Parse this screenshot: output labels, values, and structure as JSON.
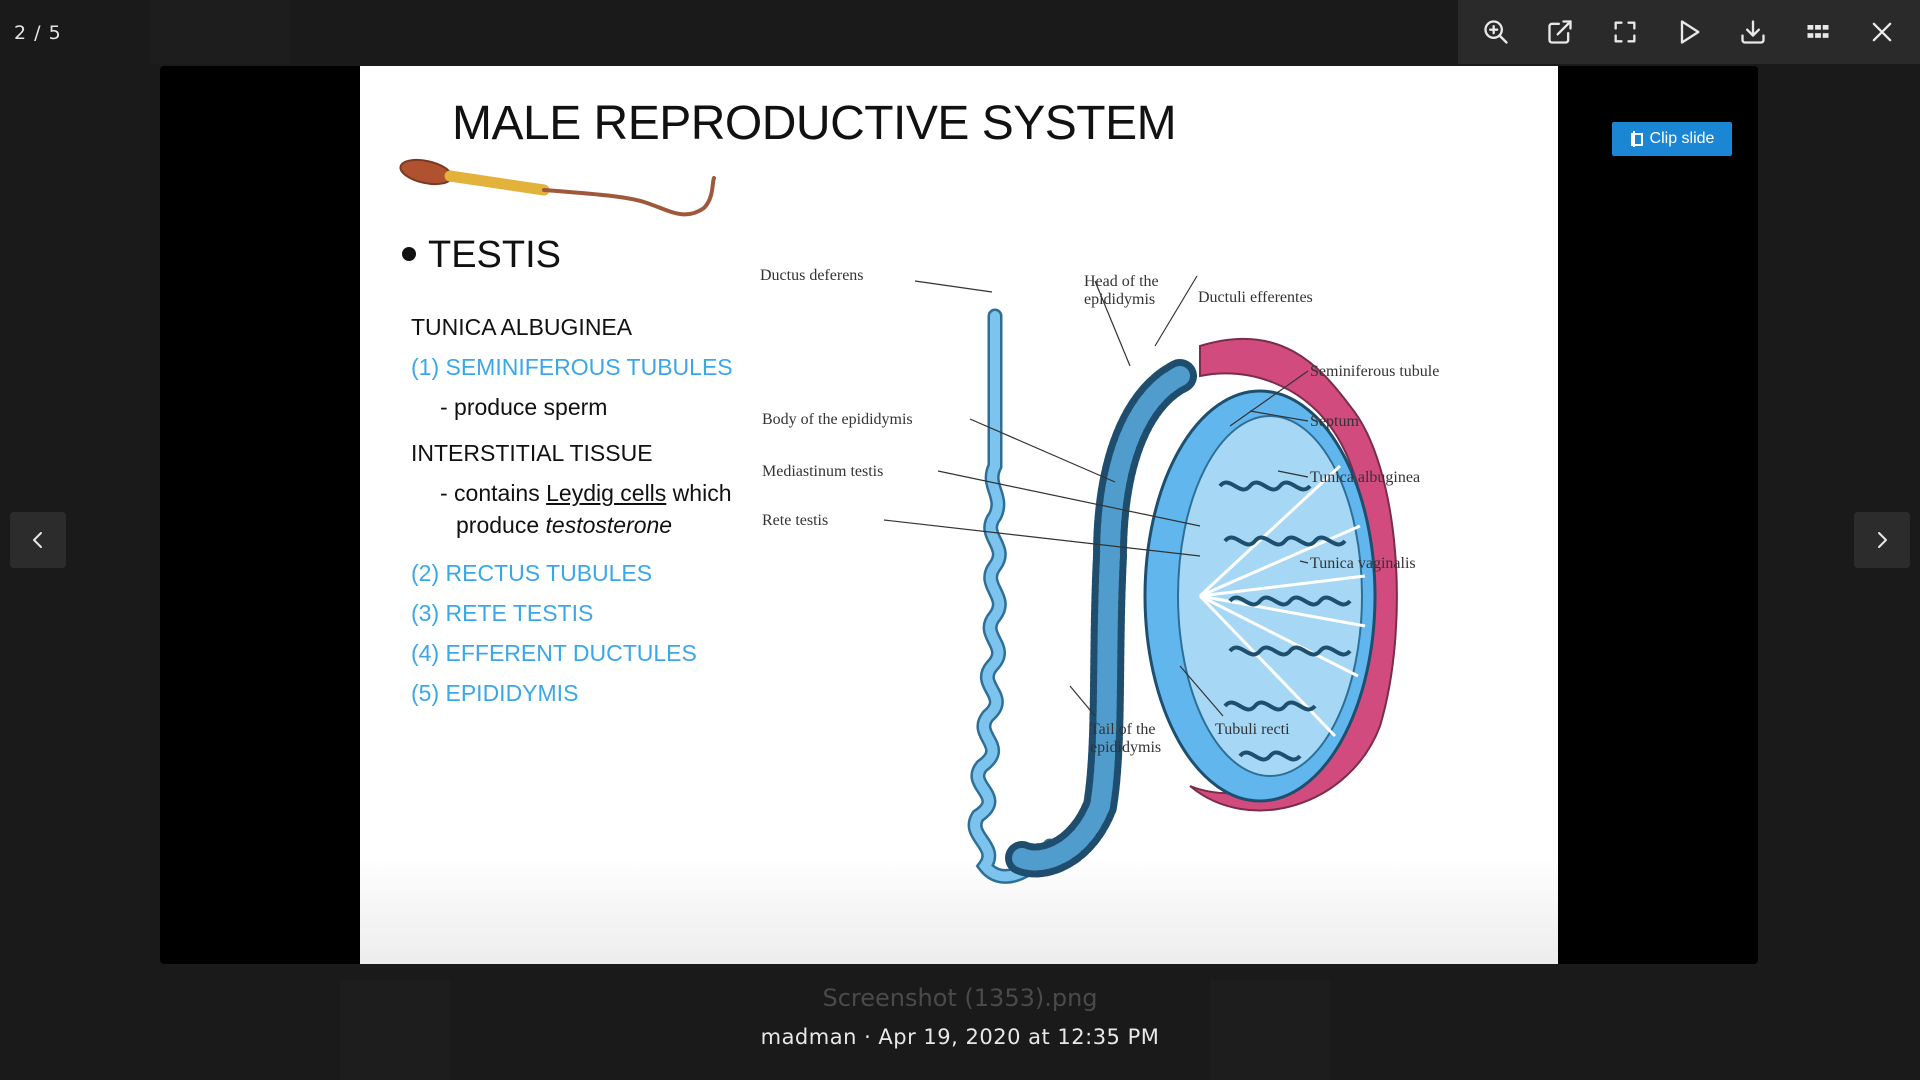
{
  "counter": "2 / 5",
  "toolbar": {
    "icons": [
      "zoom-in-icon",
      "open-external-icon",
      "fullscreen-icon",
      "play-icon",
      "download-icon",
      "grid-icon",
      "close-icon"
    ]
  },
  "viewer": {
    "clip_label": "Clip slide"
  },
  "slide": {
    "title": "MALE REPRODUCTIVE SYSTEM",
    "bullet": "TESTIS",
    "lines": {
      "tunica": "TUNICA ALBUGINEA",
      "sem": "(1) SEMINIFEROUS TUBULES",
      "sperm_pre": "- produce sperm",
      "interstitial": "INTERSTITIAL TISSUE",
      "contains_a": "- contains ",
      "contains_u": "Leydig cells",
      "contains_b": " which",
      "produce_a": "produce ",
      "produce_i": "testosterone",
      "rectus": "(2) RECTUS TUBULES",
      "rete": "(3) RETE TESTIS",
      "efferent": "(4) EFFERENT DUCTULES",
      "epididymis": "(5) EPIDIDYMIS"
    },
    "diagram_labels": {
      "ductus": "Ductus deferens",
      "head1": "Head of the",
      "head2": "epididymis",
      "ductuli": "Ductuli efferentes",
      "semtub": "Seminiferous tubule",
      "body": "Body of the epididymis",
      "septum": "Septum",
      "mediastinum": "Mediastinum testis",
      "tunica_alb": "Tunica albuginea",
      "rete": "Rete testis",
      "tunica_vag": "Tunica vaginalis",
      "tail1": "Tail of the",
      "tail2": "epididymis",
      "tubuli": "Tubuli recti"
    }
  },
  "caption": {
    "filename": "Screenshot (1353).png",
    "meta": "madman · Apr 19, 2020 at 12:35 PM"
  }
}
